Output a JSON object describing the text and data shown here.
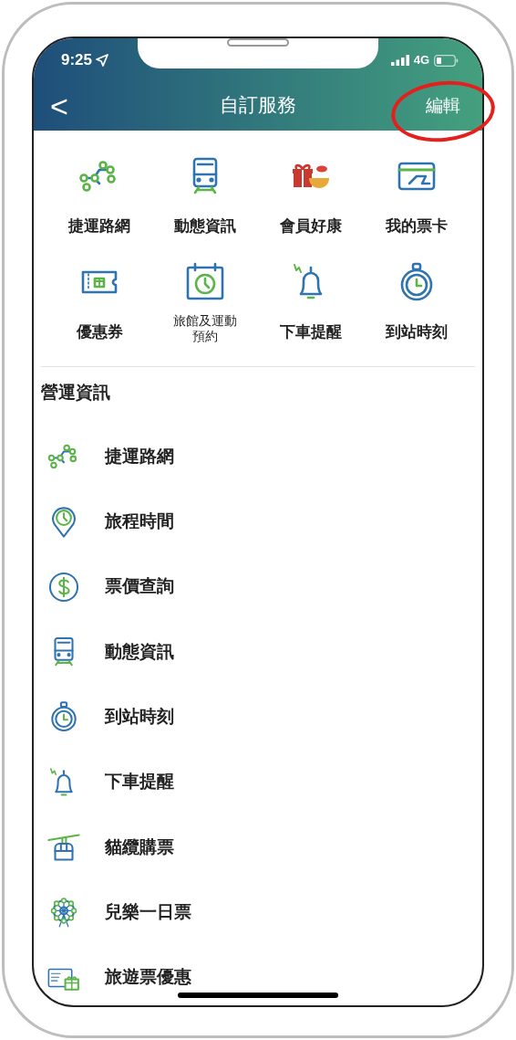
{
  "status_bar": {
    "time": "9:25",
    "network": "4G"
  },
  "nav": {
    "back": "<",
    "title": "自訂服務",
    "action": "編輯"
  },
  "shortcuts": [
    {
      "kind": "route",
      "label": "捷運路網"
    },
    {
      "kind": "train",
      "label": "動態資訊"
    },
    {
      "kind": "gift",
      "label": "會員好康"
    },
    {
      "kind": "card",
      "label": "我的票卡"
    },
    {
      "kind": "coupon",
      "label": "優惠券"
    },
    {
      "kind": "calendar",
      "label": "旅館及運動預約"
    },
    {
      "kind": "bell",
      "label": "下車提醒"
    },
    {
      "kind": "stopwatch",
      "label": "到站時刻"
    }
  ],
  "section": {
    "title": "營運資訊",
    "items": [
      {
        "kind": "route",
        "label": "捷運路網"
      },
      {
        "kind": "pin",
        "label": "旅程時間"
      },
      {
        "kind": "dollar",
        "label": "票價查詢"
      },
      {
        "kind": "train",
        "label": "動態資訊"
      },
      {
        "kind": "stopwatch",
        "label": "到站時刻"
      },
      {
        "kind": "bell",
        "label": "下車提醒"
      },
      {
        "kind": "gondola",
        "label": "貓纜購票"
      },
      {
        "kind": "wheel",
        "label": "兒樂一日票"
      },
      {
        "kind": "pass",
        "label": "旅遊票優惠"
      }
    ]
  }
}
